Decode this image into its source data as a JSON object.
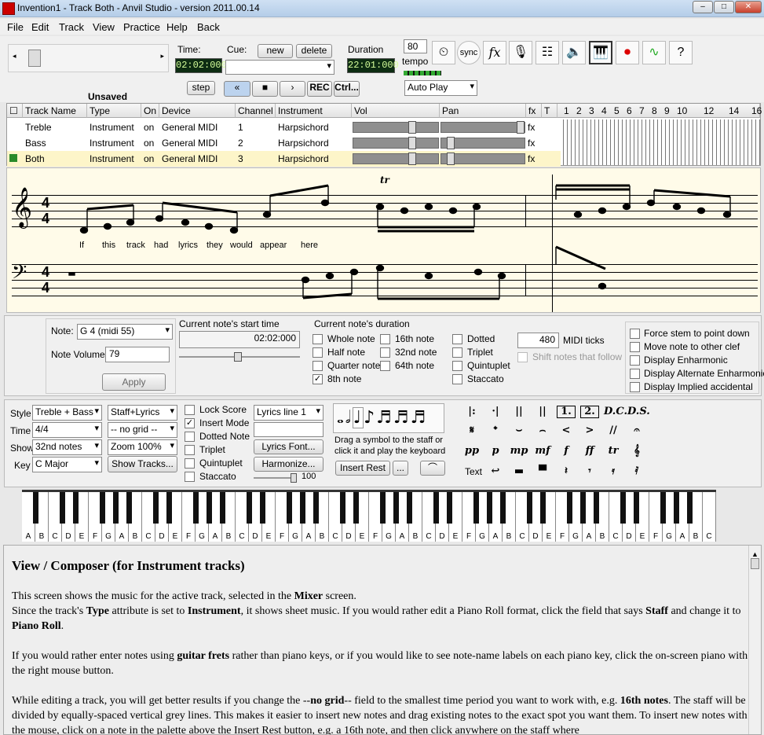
{
  "window": {
    "title": "Invention1 - Track Both - Anvil Studio - version 2011.00.14"
  },
  "menu": [
    "File",
    "Edit",
    "Track",
    "View",
    "Practice",
    "Help",
    "Back"
  ],
  "transport": {
    "time_label": "Time:",
    "time_value": "02:02:000",
    "cue_label": "Cue:",
    "new_label": "new",
    "delete_label": "delete",
    "duration_label": "Duration",
    "duration_value": "22:01:000",
    "tempo_value": "80",
    "tempo_label": "tempo",
    "step_label": "step",
    "rec_label": "REC",
    "ctrl_label": "Ctrl...",
    "playmode": "Auto Play",
    "unsaved": "Unsaved",
    "sync_label": "sync",
    "fx_label": "fx"
  },
  "mixer": {
    "headers": [
      "Track Name",
      "Type",
      "On",
      "Device",
      "Channel",
      "Instrument",
      "Vol",
      "Pan",
      "fx",
      "T"
    ],
    "measures": [
      "1",
      "2",
      "3",
      "4",
      "5",
      "6",
      "7",
      "8",
      "9",
      "10",
      "12",
      "14",
      "16"
    ],
    "rows": [
      {
        "name": "Treble",
        "type": "Instrument",
        "on": "on",
        "device": "General MIDI",
        "channel": "1",
        "instrument": "Harpsichord",
        "fx": "fx",
        "vol": 0.71,
        "pan": 1.0
      },
      {
        "name": "Bass",
        "type": "Instrument",
        "on": "on",
        "device": "General MIDI",
        "channel": "2",
        "instrument": "Harpsichord",
        "fx": "fx",
        "vol": 0.71,
        "pan": 0.07
      },
      {
        "name": "Both",
        "type": "Instrument",
        "on": "on",
        "device": "General MIDI",
        "channel": "3",
        "instrument": "Harpsichord",
        "fx": "fx",
        "vol": 0.71,
        "pan": 0.07
      }
    ]
  },
  "score": {
    "lyrics": [
      "If",
      "this",
      "track",
      "had",
      "lyrics",
      "they",
      "would",
      "appear",
      "here"
    ],
    "time_sig": [
      "4",
      "4"
    ],
    "trill": "tr"
  },
  "noteprops": {
    "note_label": "Note:",
    "note_value": "G 4 (midi 55)",
    "volume_label": "Note Volume:",
    "volume_value": "79",
    "apply_label": "Apply",
    "start_label": "Current note's start time",
    "start_value": "02:02:000",
    "duration_label": "Current note's duration",
    "durations": [
      {
        "label": "Whole note",
        "checked": false
      },
      {
        "label": "Half note",
        "checked": false
      },
      {
        "label": "Quarter note",
        "checked": false
      },
      {
        "label": "8th note",
        "checked": true
      },
      {
        "label": "16th note",
        "checked": false
      },
      {
        "label": "32nd note",
        "checked": false
      },
      {
        "label": "64th note",
        "checked": false
      }
    ],
    "mods": [
      {
        "label": "Dotted"
      },
      {
        "label": "Triplet"
      },
      {
        "label": "Quintuplet"
      },
      {
        "label": "Staccato"
      }
    ],
    "ticks_value": "480",
    "ticks_label": "MIDI ticks",
    "shift_label": "Shift notes that follow",
    "options": [
      "Force stem to point down",
      "Move note to other clef",
      "Display Enharmonic",
      "Display Alternate Enharmonic",
      "Display Implied accidental"
    ]
  },
  "editbar": {
    "style_label": "Style",
    "style_value": "Treble + Bass",
    "staff_value": "Staff+Lyrics",
    "time_label": "Time",
    "time_value": "4/4",
    "grid_value": "-- no grid --",
    "show_label": "Show",
    "show_value": "32nd notes",
    "zoom_value": "Zoom 100%",
    "key_label": "Key",
    "key_value": "C Major",
    "show_tracks": "Show Tracks...",
    "checks": [
      {
        "label": "Lock Score",
        "checked": false
      },
      {
        "label": "Insert Mode",
        "checked": true
      },
      {
        "label": "Dotted Note",
        "checked": false
      },
      {
        "label": "Triplet",
        "checked": false
      },
      {
        "label": "Quintuplet",
        "checked": false
      },
      {
        "label": "Staccato",
        "checked": false
      }
    ],
    "lyrics_line": "Lyrics line 1",
    "lyrics_font": "Lyrics Font...",
    "harmonize": "Harmonize...",
    "harmonize_value": "100",
    "drag_hint_1": "Drag a symbol to the staff or",
    "drag_hint_2": "click it and play the keyboard",
    "insert_rest": "Insert Rest",
    "ellipsis": "...",
    "text_label": "Text",
    "symbols_row1": [
      "|:",
      "·|",
      "||",
      "||",
      "1.",
      "2.",
      "D.C.",
      "D.S."
    ],
    "symbols_row2": [
      "𝄋",
      "𝄌",
      "⌣",
      "⌢",
      "<",
      ">",
      "//",
      "𝄐"
    ],
    "dynamics": [
      "pp",
      "p",
      "mp",
      "mf",
      "f",
      "ff",
      "tr",
      "𝄞"
    ]
  },
  "piano": {
    "keys": [
      "A",
      "B",
      "C",
      "D",
      "E",
      "F",
      "G",
      "A",
      "B",
      "C",
      "D",
      "E",
      "F",
      "G",
      "A",
      "B",
      "C",
      "D",
      "E",
      "F",
      "G",
      "A",
      "B",
      "C",
      "D",
      "E",
      "F",
      "G",
      "A",
      "B",
      "C",
      "D",
      "E",
      "F",
      "G",
      "A",
      "B",
      "C",
      "D",
      "E",
      "F",
      "G",
      "A",
      "B",
      "C",
      "D",
      "E",
      "F",
      "G",
      "A",
      "B",
      "C"
    ]
  },
  "help": {
    "title": "View / Composer (for Instrument tracks)",
    "p1a": "This screen shows the music for the active track, selected in the ",
    "p1b": "Mixer",
    "p1c": " screen.",
    "p2a": "Since the track's ",
    "p2b": "Type",
    "p2c": " attribute is set to ",
    "p2d": "Instrument",
    "p2e": ", it shows sheet music. If you would rather edit a Piano Roll format, click the field that says ",
    "p2f": "Staff",
    "p2g": " and change it to ",
    "p2h": "Piano Roll",
    "p2i": ".",
    "p3a": "If you would rather enter notes using ",
    "p3b": "guitar frets",
    "p3c": " rather than piano keys, or if you would like to see note-name labels on each piano key, click the on-screen piano with the right mouse button.",
    "p4a": "While editing a track, you will get better results if you change the --",
    "p4b": "no grid",
    "p4c": "-- field to the smallest time period you want to work with, e.g. ",
    "p4d": "16th notes",
    "p4e": ". The staff will be divided by equally-spaced vertical grey lines. This makes it easier to insert new notes and drag existing notes to the exact spot you want them. To insert new notes with the mouse, click on a note in the palette above the Insert Rest button, e.g. a 16th note, and then click anywhere on the staff where"
  }
}
